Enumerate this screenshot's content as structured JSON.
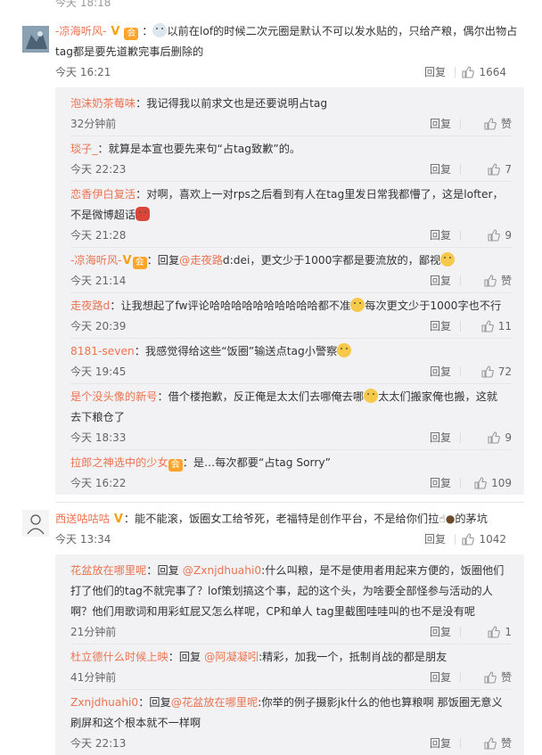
{
  "top_fragment": "今天 18:18",
  "reply_label": "回复",
  "threads": [
    {
      "user": "-凉海听风-",
      "text": "以前在lof的时候二次元圈是默认不可以发水贴的，只给产粮，偶尔出物占tag都是要先道歉完事后删除的",
      "time": "今天 16:21",
      "likes": "1664",
      "replies": [
        {
          "user": "泡沫奶茶莓味",
          "text": "：我记得我以前求文也是还要说明占tag",
          "time": "32分钟前",
          "likes": "赞"
        },
        {
          "user": "琰子_",
          "text": "：就算是本宣也要先来句“占tag致歉”的。",
          "time": "今天 22:23",
          "likes": "7"
        },
        {
          "user": "恋香伊白复活",
          "text": "：对啊，喜欢上一对rps之后看到有人在tag里发日常我都懵了，这是lofter，不是微博超话",
          "time": "今天 21:28",
          "likes": "9"
        },
        {
          "user": "-凉海听风-",
          "text": "：回复",
          "mention": "@走夜路",
          "text2": "d:dei，更文少于1000字都是要流放的，鄙视",
          "time": "今天 21:14",
          "likes": "赞"
        },
        {
          "user": "走夜路d",
          "text": "：让我想起了fw评论哈哈哈哈哈哈哈哈哈哈都不准",
          "text2": "每次更文少于1000字也不行",
          "time": "今天 20:39",
          "likes": "11"
        },
        {
          "user": "8181-seven",
          "text": "：我感觉得给这些“饭圈”输送点tag小警察",
          "time": "今天 19:45",
          "likes": "72"
        },
        {
          "user": "是个没头像的新号",
          "text": "：借个楼抱歉，反正俺是太太们去哪俺去哪",
          "text2": "太太们搬家俺也搬，这就去下粮仓了",
          "time": "今天 18:33",
          "likes": "9"
        },
        {
          "user": "拉郎之神选中的少女",
          "text": "：是…每次都要“占tag Sorry”",
          "time": "今天 16:22",
          "likes": "109"
        }
      ]
    },
    {
      "user": "西送咕咕咕",
      "text": "：能不能滚，饭圈女工给爷死，老福特是创作平台，不是给你们拉",
      "text2": "的茅坑",
      "time": "今天 13:34",
      "likes": "1042",
      "replies": [
        {
          "user": "花盆放在哪里呢",
          "text": "：回复 ",
          "mention": "@Zxnjdhuahi0",
          "text2": ":什么叫粮，是不是使用者用起来方便的，饭圈他们打了他们的tag不就完事了？lof策划搞这个事，起的这个头，为啥要全部怪参与活动的人啊？他们用歌词和用彩虹屁又怎么样呢，CP和单人 tag里截图哇哇叫的也不是没有呢",
          "time": "21分钟前",
          "likes": "1"
        },
        {
          "user": "杜立德什么时候上映",
          "text": "：回复 ",
          "mention": "@阿凝凝吲",
          "text2": ":精彩，加我一个，抵制肖战的都是朋友",
          "time": "41分钟前",
          "likes": "赞"
        },
        {
          "user": "Zxnjdhuahi0",
          "text": "：回复",
          "mention": "@花盆放在哪里呢",
          "text2": ":你举的例子摄影jk什么的他也算粮啊  那饭圈无意义刷屏和这个根本就不一样啊",
          "time": "今天 22:13",
          "likes": "赞"
        }
      ]
    }
  ],
  "colors": {
    "username": "#eb7350",
    "reply_bg": "#f2f2f5",
    "text": "#333333",
    "meta": "#666666"
  }
}
